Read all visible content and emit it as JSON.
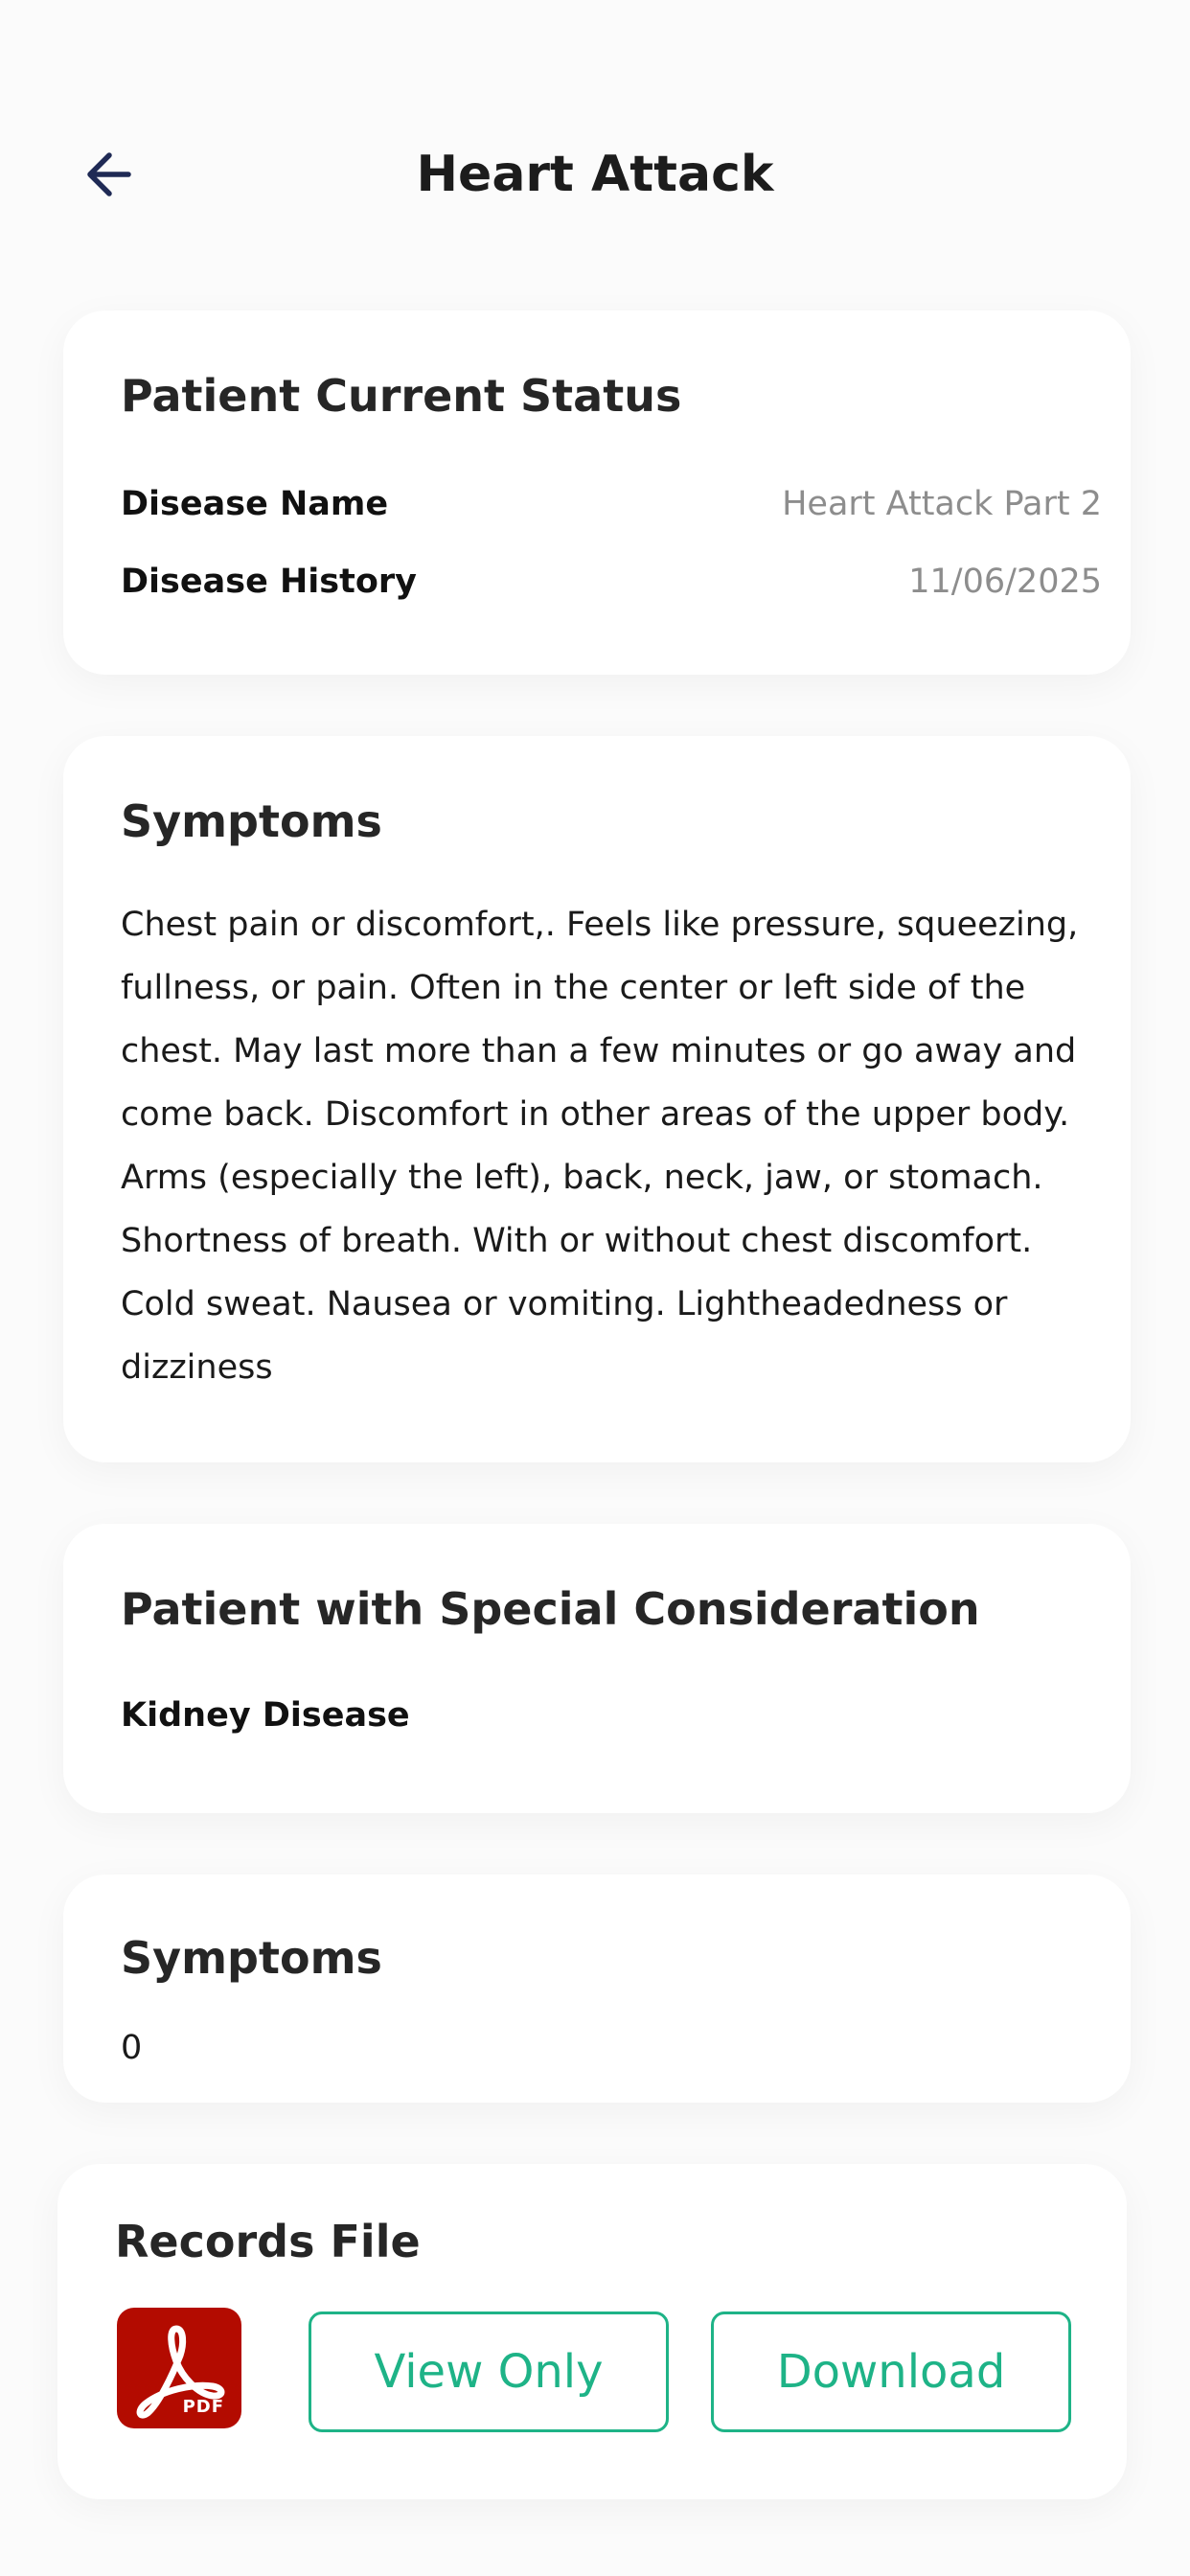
{
  "header": {
    "title": "Heart Attack",
    "back_icon": "arrow-left-icon"
  },
  "current_status": {
    "title": "Patient Current Status",
    "disease_name_label": "Disease Name",
    "disease_name_value": "Heart Attack Part 2",
    "disease_history_label": "Disease History",
    "disease_history_value": "11/06/2025"
  },
  "symptoms_card": {
    "title": "Symptoms",
    "text": "Chest pain or discomfort,. Feels like pressure, squeezing, fullness, or pain. Often in the center or left side of the chest. May last more than a few minutes or go away and come back. Discomfort in other areas of the upper body. Arms (especially the left), back, neck, jaw, or stomach. Shortness of breath. With or without chest discomfort. Cold sweat. Nausea or vomiting. Lightheadedness or dizziness"
  },
  "special_consideration": {
    "title": "Patient with Special Consideration",
    "item": "Kidney Disease"
  },
  "symptoms_count_card": {
    "title": "Symptoms",
    "value": "0"
  },
  "records": {
    "title": "Records File",
    "file_icon": "pdf-icon",
    "file_badge": "PDF",
    "view_label": "View Only",
    "download_label": "Download"
  },
  "colors": {
    "accent": "#1eb387",
    "pdf_red": "#b30b00",
    "back_arrow": "#1f2a55",
    "muted_text": "#8d8d8d"
  }
}
